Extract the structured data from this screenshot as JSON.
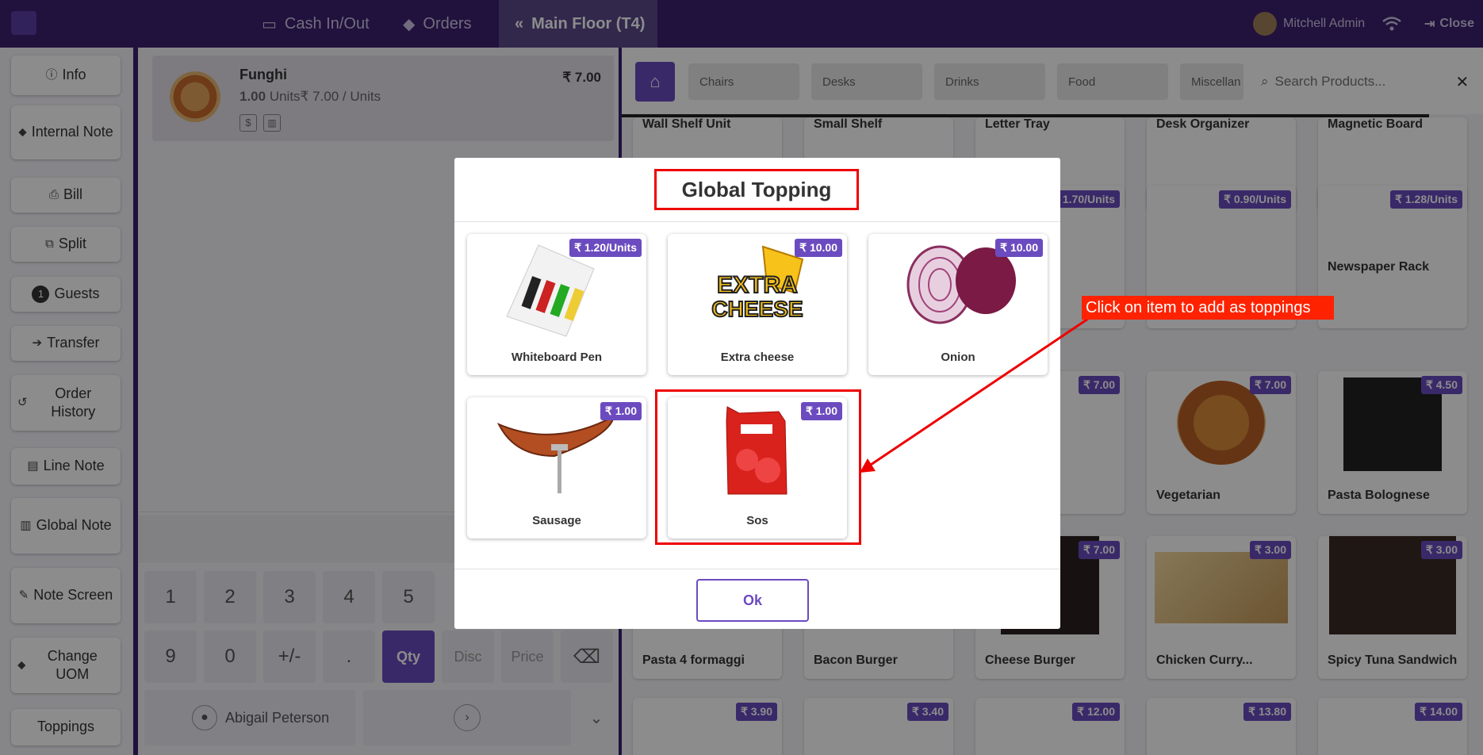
{
  "topbar": {
    "cash_label": "Cash In/Out",
    "orders_label": "Orders",
    "floor_label": "Main Floor (T4)",
    "user": "Mitchell Admin",
    "close_label": "Close"
  },
  "left_actions": [
    {
      "label": "Info",
      "icon": "info-icon"
    },
    {
      "label": "Internal Note",
      "icon": "tag-icon"
    },
    {
      "label": "Bill",
      "icon": "printer-icon"
    },
    {
      "label": "Split",
      "icon": "split-icon"
    },
    {
      "label": "Guests",
      "icon": "guests-badge",
      "badge": "1"
    },
    {
      "label": "Transfer",
      "icon": "arrow-right-icon"
    },
    {
      "label": "Order History",
      "icon": "history-icon"
    },
    {
      "label": "Line Note",
      "icon": "note-icon"
    },
    {
      "label": "Global Note",
      "icon": "document-icon"
    },
    {
      "label": "Note Screen",
      "icon": "edit-icon"
    },
    {
      "label": "Change UOM",
      "icon": "tag-icon"
    },
    {
      "label": "Toppings",
      "icon": ""
    }
  ],
  "order": {
    "product": "Funghi",
    "price": "₹ 7.00",
    "qty": "1.00",
    "unit_info": "Units₹ 7.00 / Units"
  },
  "numpad": {
    "row1": [
      "1",
      "2",
      "3",
      "4",
      "5"
    ],
    "row2": [
      "9",
      "0",
      "+/-",
      ".",
      "Qty",
      "Disc",
      "Price"
    ],
    "customer": "Abigail Peterson"
  },
  "categories": [
    "Chairs",
    "Desks",
    "Drinks",
    "Food",
    "Miscellan"
  ],
  "search": {
    "placeholder": "Search Products..."
  },
  "bg_products": [
    {
      "name": "Wall Shelf Unit"
    },
    {
      "name": "Small Shelf"
    },
    {
      "name": "Letter Tray"
    },
    {
      "name": "Desk Organizer"
    },
    {
      "name": "Magnetic Board"
    },
    {
      "name": "",
      "price": "1.70/Units"
    },
    {
      "name": "",
      "price": "₹ 0.90/Units"
    },
    {
      "name": "Newspaper Rack",
      "price": "₹ 1.28/Units"
    },
    {
      "name": "",
      "price": "₹ 7.00"
    },
    {
      "name": "Vegetarian",
      "price": "₹ 7.00"
    },
    {
      "name": "Pasta Bolognese",
      "price": "₹ 4.50"
    },
    {
      "name": "Pasta 4 formaggi"
    },
    {
      "name": "Bacon Burger"
    },
    {
      "name": "Cheese Burger",
      "price": "₹ 7.00"
    },
    {
      "name": "Chicken Curry...",
      "price": "₹ 3.00"
    },
    {
      "name": "Spicy Tuna Sandwich",
      "price": "₹ 3.00"
    },
    {
      "price": "₹ 3.90"
    },
    {
      "price": "₹ 3.40"
    },
    {
      "price": "₹ 12.00"
    },
    {
      "price": "₹ 13.80"
    },
    {
      "price": "₹ 14.00"
    }
  ],
  "modal": {
    "title": "Global Topping",
    "items": [
      {
        "name": "Whiteboard Pen",
        "price": "₹ 1.20/Units"
      },
      {
        "name": "Extra cheese",
        "price": "₹ 10.00"
      },
      {
        "name": "Onion",
        "price": "₹ 10.00"
      },
      {
        "name": "Sausage",
        "price": "₹ 1.00"
      },
      {
        "name": "Sos",
        "price": "₹ 1.00"
      }
    ],
    "ok_label": "Ok",
    "cheese_text1": "EXTRA",
    "cheese_text2": "CHEESE"
  },
  "annotation": {
    "text": "Click on item to add as toppings",
    "color": "#ff2200"
  },
  "colors": {
    "brand": "#3b1f70",
    "accent": "#6b4bbf",
    "highlight": "#ee0000"
  }
}
